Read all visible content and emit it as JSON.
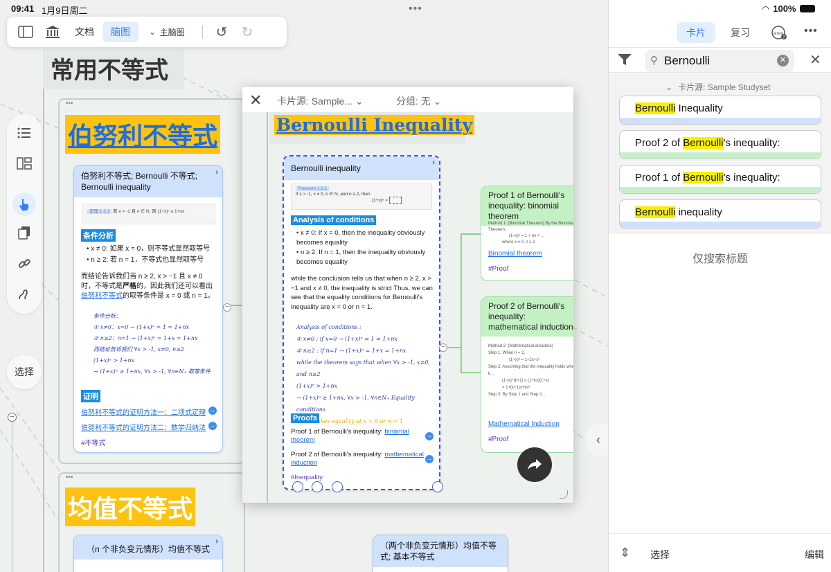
{
  "status": {
    "time": "09:41",
    "date": "1月9日周二",
    "battery": "100%"
  },
  "toolbar": {
    "doc_label": "文档",
    "mindmap_label": "脑图",
    "main_map_label": "主脑图"
  },
  "sidebar": {
    "select_label": "选择"
  },
  "canvas": {
    "map_title": "常用不等式",
    "topic1_title": "伯努利不等式",
    "topic2_title": "均值不等式",
    "card1": {
      "header": "伯努利不等式; Bernoulli 不等式; Bernoulli inequality",
      "theorem_line": "若 x > -1 且 n ∈ N, 则 (1+x)ⁿ ≥ 1+nx",
      "cond_title": "条件分析",
      "cond1": "x ≠ 0: 如果 x = 0，则不等式显然取等号",
      "cond2": "n ≥ 2: 若 n = 1，不等式也显然取等号",
      "para_pre": "而结论告诉我们当 n ≥ 2, x > −1 且 x ≠ 0 时，不等式是",
      "para_bold": "严格",
      "para_mid": "的，因此我们还可以看出",
      "para_link": "伯努利不等式",
      "para_post": "的取等条件是 x = 0 或 n = 1。",
      "hand_lines": [
        "条件分析：",
        "① x≠0：x=0 → (1+x)ⁿ = 1 = 1+nx",
        "② n≥2：n=1 → (1+x)ⁿ = 1+x = 1+nx",
        "而结论告诉我们 ∀x > -1, x≠0, n≥2",
        "(1+x)ⁿ > 1+nx",
        "→ (1+x)ⁿ ≥ 1+nx, ∀x > -1, ∀n∈N₊ 取等条件"
      ],
      "proof_title": "证明",
      "proof1": "伯努利不等式的证明方法一：二项式定理",
      "proof2": "伯努利不等式的证明方法二：数学归纳法",
      "tag": "#不等式"
    },
    "card2_header": "（n 个非负变元情形）均值不等式",
    "card3_header": "（两个非负变元情形）均值不等式; 基本不等式"
  },
  "preview": {
    "source_label": "卡片源: Sample...",
    "group_label": "分组: 无",
    "title": "Bernoulli Inequality",
    "card": {
      "header": "Bernoulli inequality",
      "theorem_tag": "Theorem 1.2.1",
      "theorem_line": "If x > -1, x ≠ 0, n ∈ N, and n ≥ 2, then",
      "analysis_title": "Analysis of conditions",
      "b1": "x ≠ 0: If x = 0, then the inequality obviously becomes equality",
      "b2": "n ≥ 2: If n = 1, then the inequality obviously becomes equality",
      "para": "while the conclusion tells us that when n ≥ 2, x > −1 and x ≠ 0, the inequality is strict Thus, we can see that the equality conditions for Bernoulli's inequality are x = 0 or n = 1.",
      "hand_lines": [
        "Analysis of conditions :",
        "① x≠0 : if x=0 → (1+x)ⁿ = 1 = 1+nx",
        "② n≥2 : if n=1 → (1+x)ⁿ = 1+x = 1+nx",
        "while the theorem says that when ∀x > -1, x≠0, and n≥2",
        "(1+x)ⁿ > 1+nx",
        "→ (1+x)ⁿ ≥ 1+nx, ∀x > -1, ∀n∈N₊ Equality conditions",
        "which takes equality at x = 0 or n = 1"
      ],
      "proofs_title": "Proofs",
      "proof1_pre": "Proof 1 of Bernoulli's inequality: ",
      "proof1_link": "binomial theorem",
      "proof2_pre": "Proof 2 of Bernoulli's inequality: ",
      "proof2_link": "mathematical induction",
      "tag": "#Inequality"
    },
    "green1": {
      "header": "Proof 1 of Bernoulli's inequality: binomial theorem",
      "method_line": "Method 1: (Binomial Theorem) By the Binomial Theorem,",
      "link": "Binomial theorem",
      "tag": "#Proof"
    },
    "green2": {
      "header": "Proof 2 of Bernoulli's inequality: mathematical induction",
      "method_line": "Method 2: (Mathematical induction)",
      "link": "Mathematical Induction",
      "tag": "#Proof"
    }
  },
  "right_panel": {
    "tab_cards": "卡片",
    "tab_review": "复习",
    "search_value": "Bernoulli",
    "source_label": "卡片源: Sample Studyset",
    "results": [
      {
        "pre": "",
        "hl": "Bernoulli",
        "post": " Inequality",
        "bar_color": "#cfe1fb"
      },
      {
        "pre": "Proof 2 of ",
        "hl": "Bernoulli",
        "post": "'s inequality:",
        "bar_color": "#c8f0c8"
      },
      {
        "pre": "Proof 1 of ",
        "hl": "Bernoulli",
        "post": "'s inequality:",
        "bar_color": "#c8f0c8"
      },
      {
        "pre": "",
        "hl": "Bernoulli",
        "post": " inequality",
        "bar_color": "#cfe1fb"
      }
    ],
    "title_only_label": "仅搜索标题",
    "bottom_select": "选择",
    "bottom_edit": "编辑"
  },
  "colors": {
    "accent": "#2f7ef7",
    "highlight": "#ffc20e",
    "search_highlight": "#f7f000"
  }
}
